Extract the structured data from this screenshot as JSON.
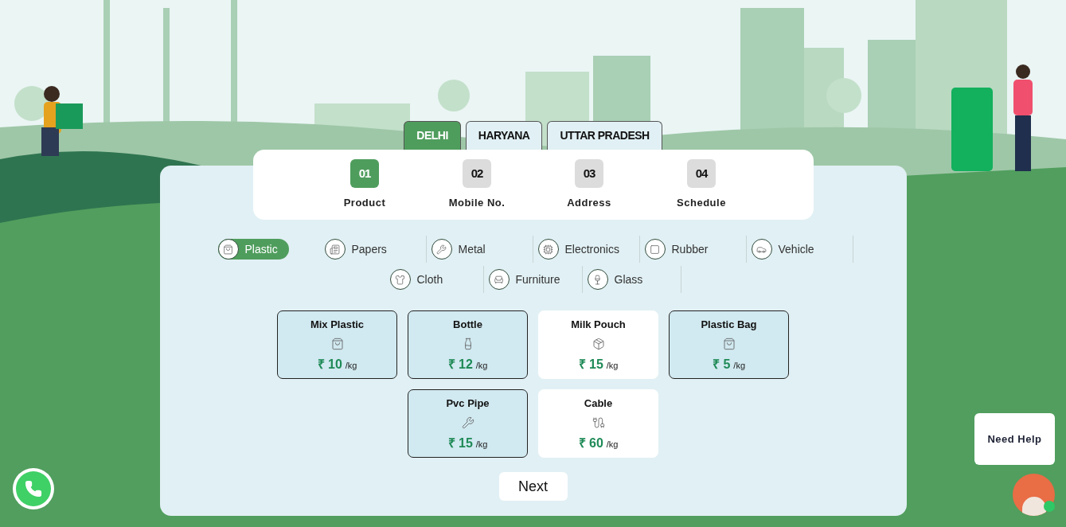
{
  "states": [
    {
      "label": "DELHI",
      "selected": true
    },
    {
      "label": "HARYANA",
      "selected": false
    },
    {
      "label": "UTTAR PRADESH",
      "selected": false
    }
  ],
  "steps": [
    {
      "number": "01",
      "label": "Product",
      "selected": true
    },
    {
      "number": "02",
      "label": "Mobile No.",
      "selected": false
    },
    {
      "number": "03",
      "label": "Address",
      "selected": false
    },
    {
      "number": "04",
      "label": "Schedule",
      "selected": false
    }
  ],
  "categories": [
    {
      "label": "Plastic",
      "selected": true
    },
    {
      "label": "Papers",
      "selected": false
    },
    {
      "label": "Metal",
      "selected": false
    },
    {
      "label": "Electronics",
      "selected": false
    },
    {
      "label": "Rubber",
      "selected": false
    },
    {
      "label": "Vehicle",
      "selected": false
    },
    {
      "label": "Cloth",
      "selected": false
    },
    {
      "label": "Furniture",
      "selected": false
    },
    {
      "label": "Glass",
      "selected": false
    }
  ],
  "products": [
    {
      "name": "Mix Plastic",
      "currency": "₹",
      "price": "10",
      "unit": "/kg",
      "selected": true
    },
    {
      "name": "Bottle",
      "currency": "₹",
      "price": "12",
      "unit": "/kg",
      "selected": true
    },
    {
      "name": "Milk Pouch",
      "currency": "₹",
      "price": "15",
      "unit": "/kg",
      "selected": false
    },
    {
      "name": "Plastic Bag",
      "currency": "₹",
      "price": "5",
      "unit": "/kg",
      "selected": true
    },
    {
      "name": "Pvc Pipe",
      "currency": "₹",
      "price": "15",
      "unit": "/kg",
      "selected": true
    },
    {
      "name": "Cable",
      "currency": "₹",
      "price": "60",
      "unit": "/kg",
      "selected": false
    }
  ],
  "next_button": "Next",
  "help_button": "Need Help"
}
